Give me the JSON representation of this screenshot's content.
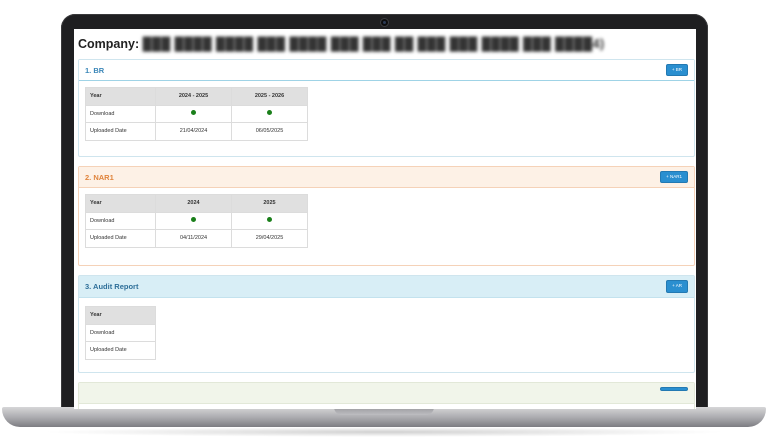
{
  "company": {
    "prefix": "Company:",
    "name": "███ ████ ████ ███ ████ ███ ███ ██ ███ ███ ████ ███ ████4)"
  },
  "sections": {
    "br": {
      "title": "1. BR",
      "button": "+ BR",
      "header_col": "Year",
      "years": [
        "2024 - 2025",
        "2025 - 2026"
      ],
      "download_label": "Download",
      "uploaded_label": "Uploaded Date",
      "uploaded": [
        "21/04/2024",
        "06/05/2025"
      ]
    },
    "nar": {
      "title": "2. NAR1",
      "button": "+ NAR1",
      "header_col": "Year",
      "years": [
        "2024",
        "2025"
      ],
      "download_label": "Download",
      "uploaded_label": "Uploaded Date",
      "uploaded": [
        "04/11/2024",
        "29/04/2025"
      ]
    },
    "audit": {
      "title": "3. Audit Report",
      "button": "+ AR",
      "header_col": "Year",
      "download_label": "Download",
      "uploaded_label": "Uploaded Date"
    }
  },
  "colors": {
    "download_dot": "#1a7f1a",
    "button": "#2a8fd0"
  },
  "icons": {
    "download": "green-dot-icon"
  }
}
